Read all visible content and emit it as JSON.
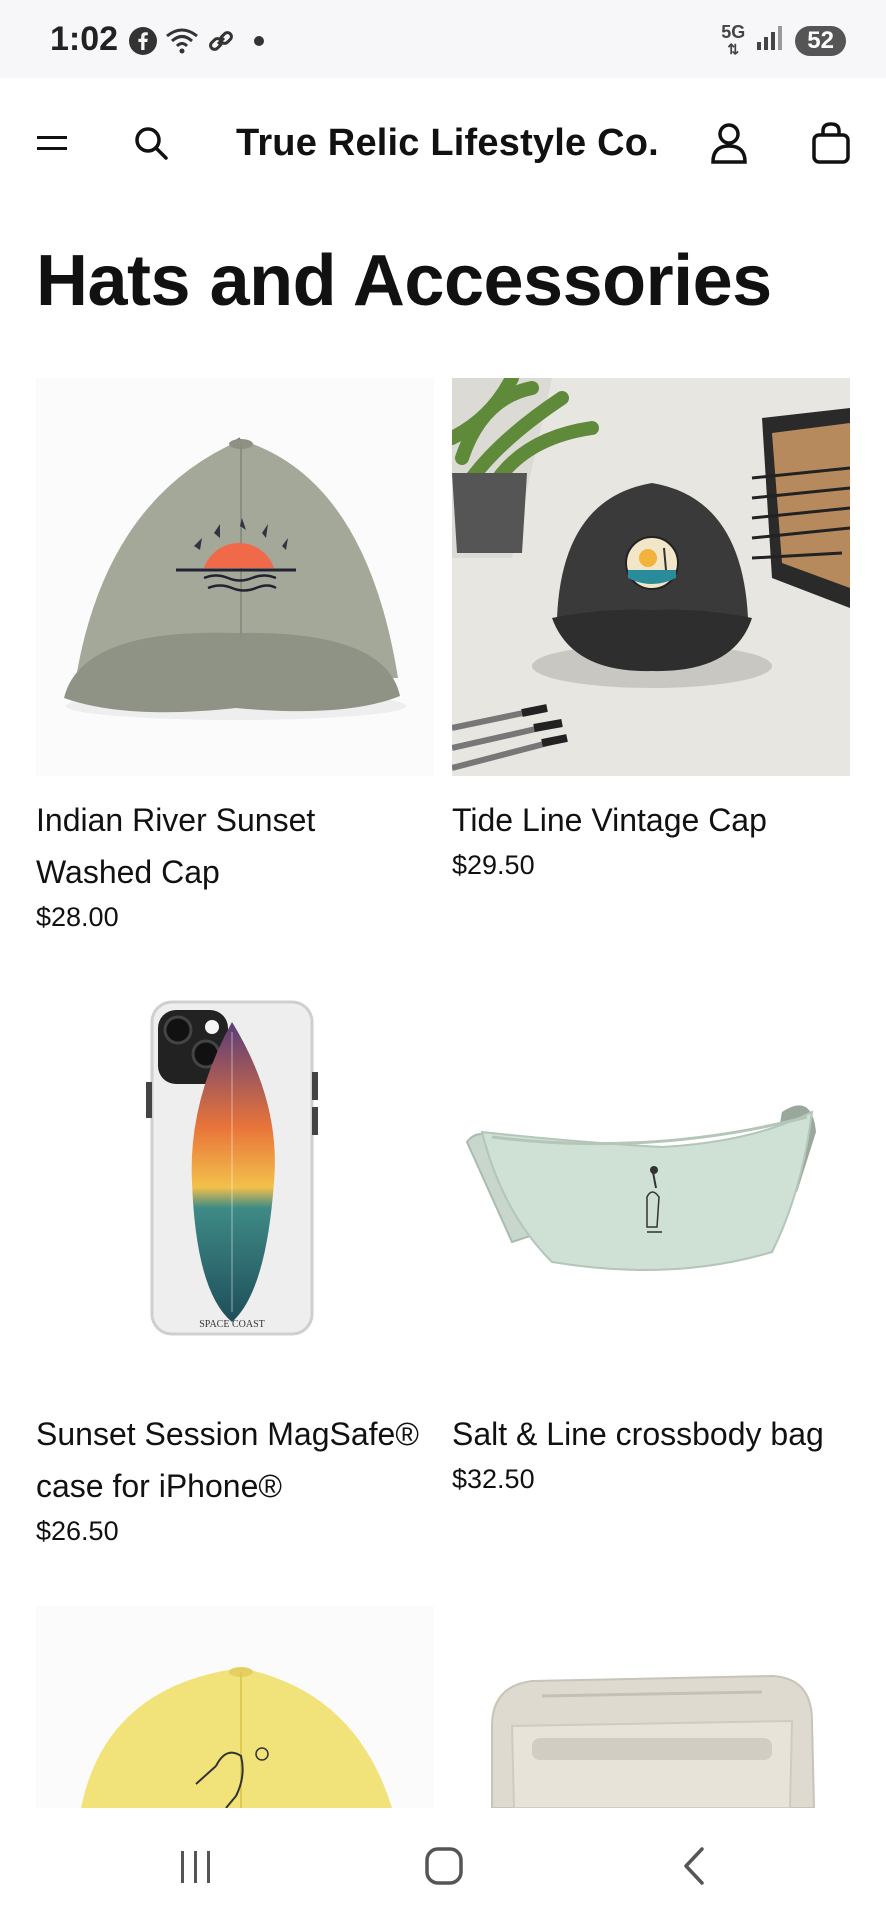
{
  "status": {
    "time": "1:02",
    "network": "5G",
    "battery": "52"
  },
  "header": {
    "brand": "True Relic Lifestyle Co."
  },
  "page": {
    "title": "Hats and Accessories"
  },
  "products": [
    {
      "name": "Indian River Sunset Washed Cap",
      "price": "$28.00",
      "image_icon": "green-washed-cap-sunset-image"
    },
    {
      "name": "Tide Line Vintage Cap",
      "price": "$29.50",
      "image_icon": "black-vintage-cap-image"
    },
    {
      "name": "Sunset Session MagSafe® case for iPhone®",
      "price": "$26.50",
      "image_icon": "surfboard-phone-case-image",
      "image_text": "SPACE COAST"
    },
    {
      "name": "Salt & Line crossbody bag",
      "price": "$32.50",
      "image_icon": "mint-crossbody-bag-image"
    },
    {
      "name": "",
      "price": "",
      "image_icon": "yellow-pelican-cap-image"
    },
    {
      "name": "",
      "price": "",
      "image_icon": "beige-bag-image"
    }
  ]
}
